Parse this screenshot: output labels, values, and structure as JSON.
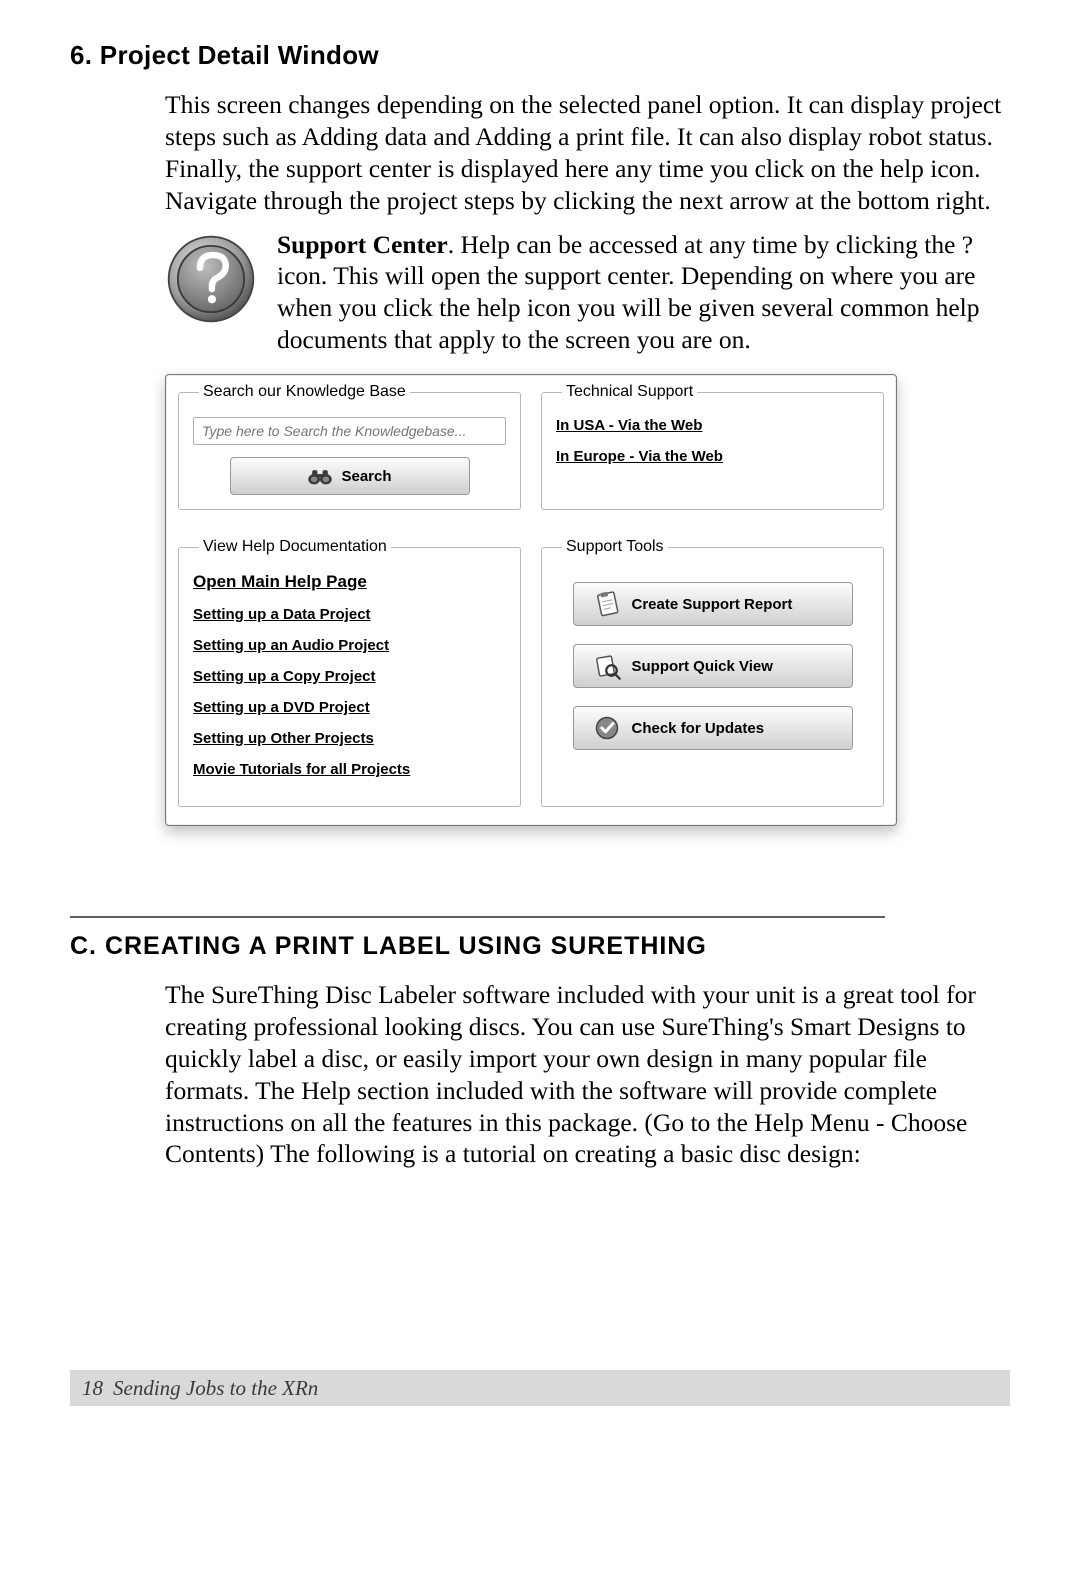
{
  "section6": {
    "heading": "6. Project Detail Window",
    "para1": "This screen changes depending on the selected panel option. It can display project steps such as Adding data and Adding a print file. It can also display robot status. Finally, the support center is displayed here any time you click on the help icon. Navigate through the project steps by clicking the next arrow at the bottom right.",
    "support_bold": "Support Center",
    "support_rest": ". Help can be accessed at any time by clicking the ? icon. This will open the support center. Depending on where you are when you click the help icon you will be given several common help documents that apply to the screen you are on."
  },
  "panel": {
    "kb": {
      "legend": "Search our Knowledge Base",
      "placeholder": "Type here to Search the Knowledgebase...",
      "search_label": "Search"
    },
    "tech": {
      "legend": "Technical Support",
      "links": [
        "In USA - Via the Web",
        "In Europe - Via the Web"
      ]
    },
    "docs": {
      "legend": "View Help Documentation",
      "links": [
        "Open Main Help Page",
        "Setting up a Data Project",
        "Setting up an Audio Project",
        "Setting up a Copy Project",
        "Setting up a DVD Project",
        "Setting up Other Projects",
        "Movie Tutorials for all Projects"
      ]
    },
    "tools": {
      "legend": "Support Tools",
      "buttons": [
        "Create Support Report",
        "Support Quick View",
        "Check for Updates"
      ]
    }
  },
  "sectionC": {
    "heading": "C. Creating a Print Label Using SureThing",
    "para": "The SureThing Disc Labeler software included with your unit is a great tool for creating professional looking discs. You can use SureThing's Smart Designs to quickly label a disc, or easily import your own design in many popular file formats. The Help section included with the software will provide complete instructions on all the features in this package. (Go to the Help Menu - Choose Contents) The following is a tutorial on creating a basic disc design:"
  },
  "footer": {
    "page_number": "18",
    "title": "Sending Jobs to the XRn"
  }
}
